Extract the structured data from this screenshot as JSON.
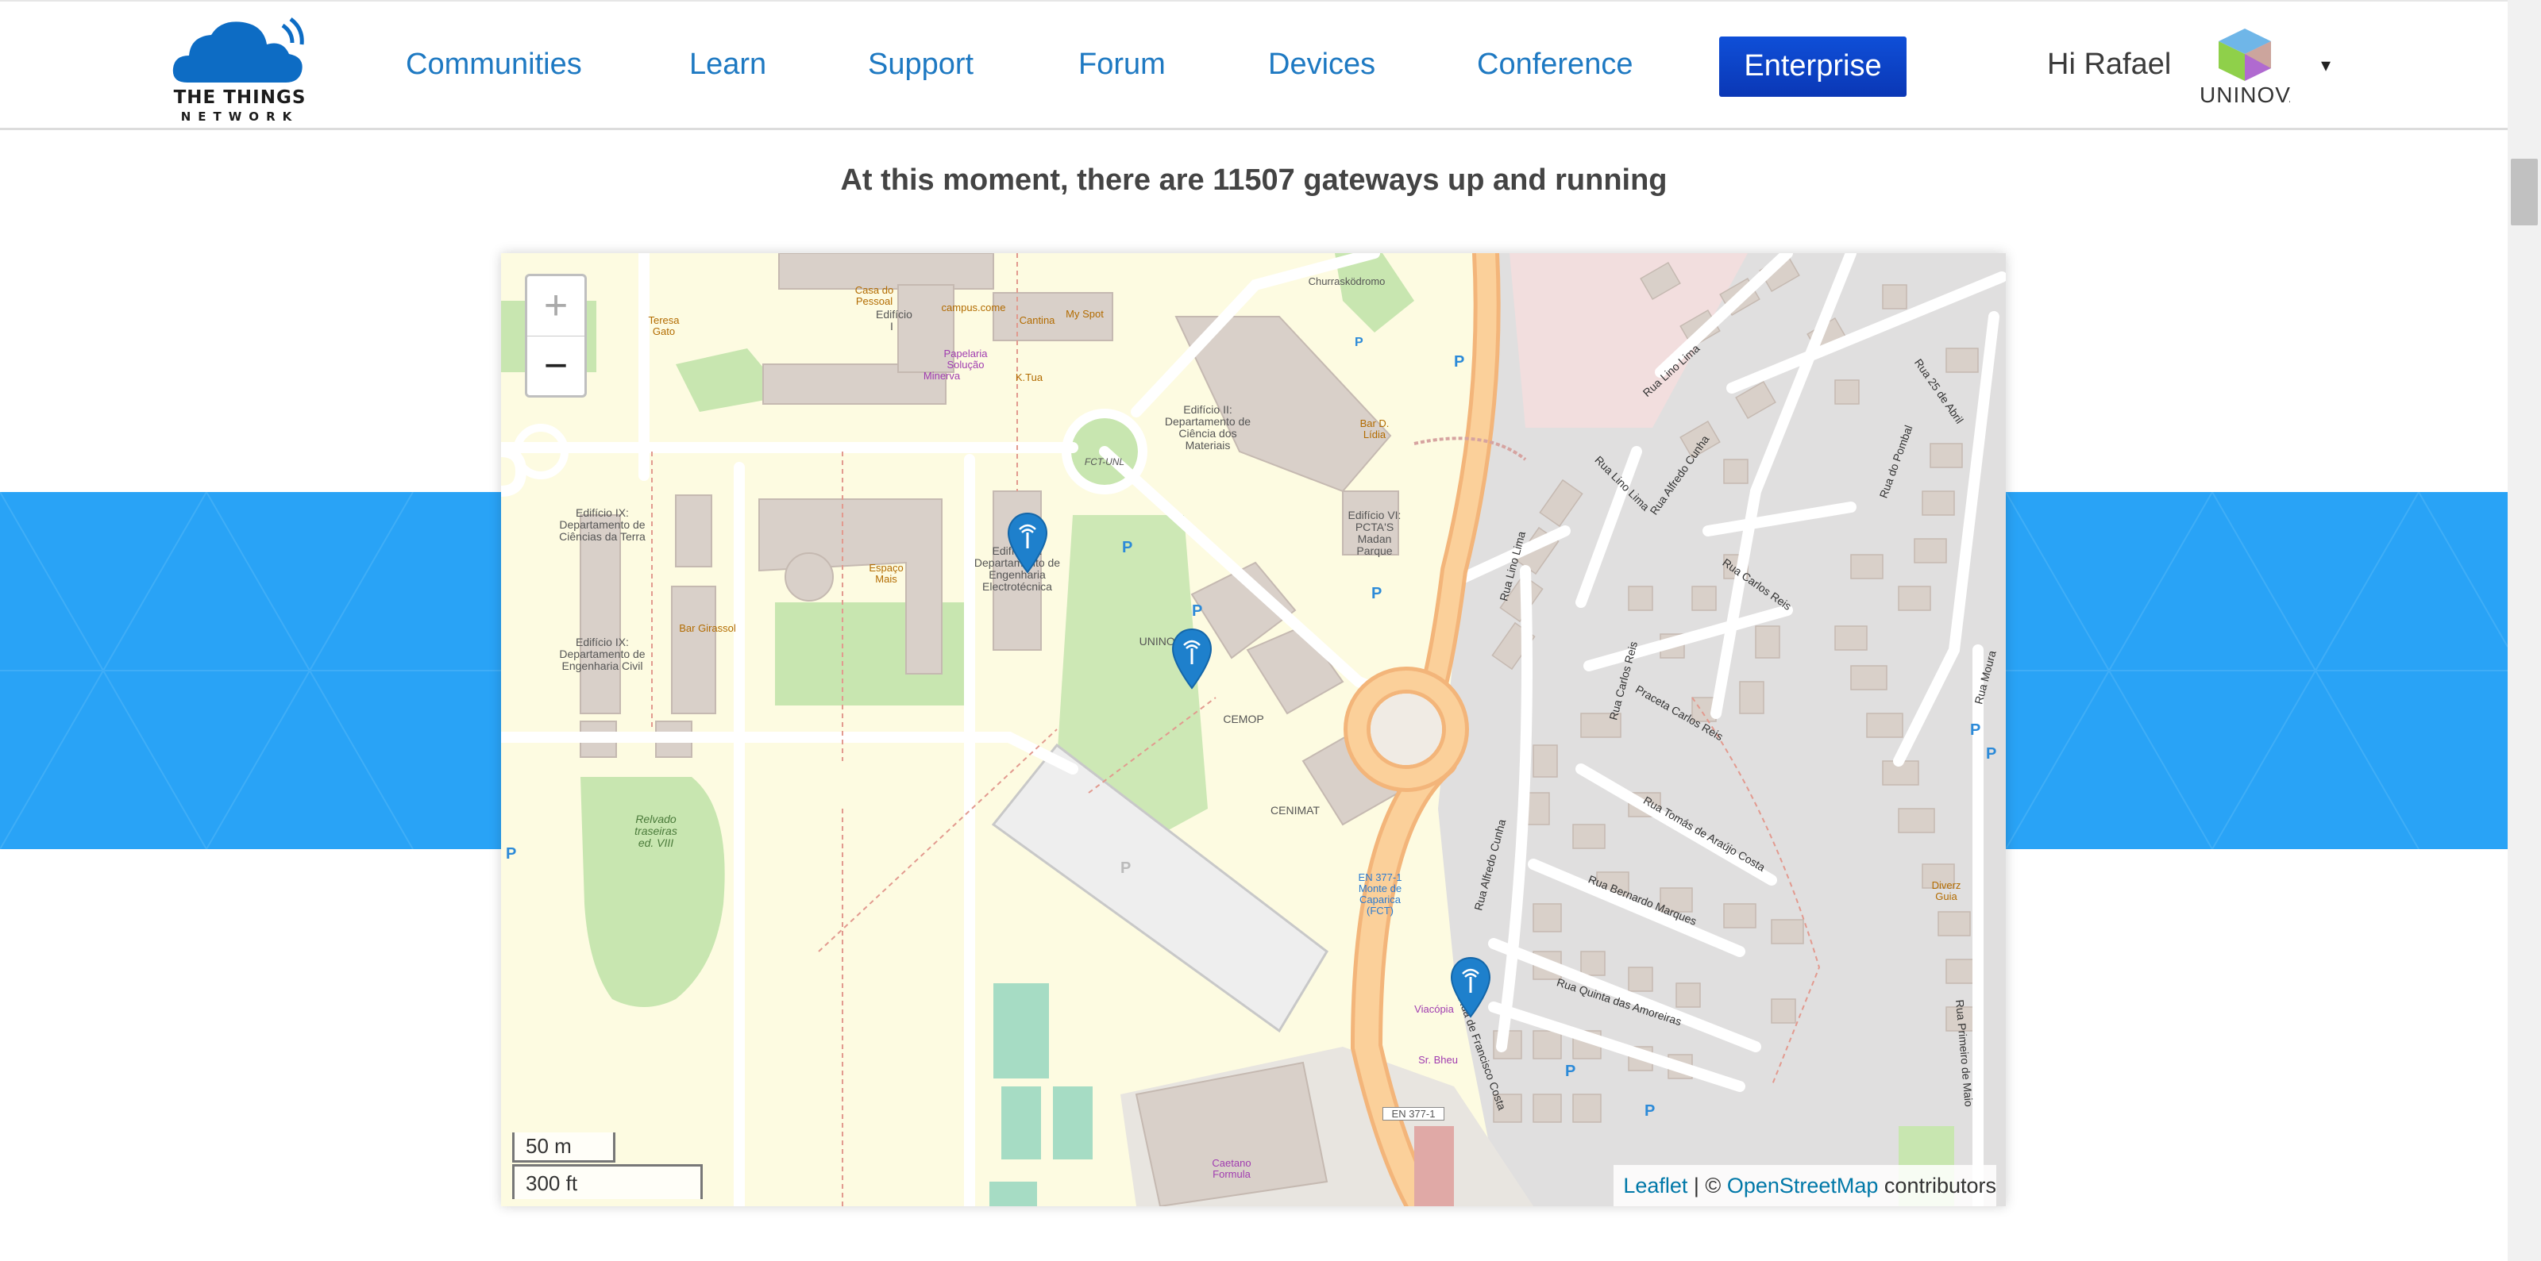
{
  "header": {
    "logo_line1": "THE THINGS",
    "logo_line2": "NETWORK",
    "nav": [
      {
        "label": "Communities"
      },
      {
        "label": "Learn"
      },
      {
        "label": "Support"
      },
      {
        "label": "Forum"
      },
      {
        "label": "Devices"
      },
      {
        "label": "Conference"
      }
    ],
    "enterprise_label": "Enterprise",
    "greeting": "Hi Rafael",
    "avatar_text": "UNINOVA",
    "dropdown_icon": "▾"
  },
  "headline": "At this moment, there are 11507 gateways up and running",
  "map": {
    "zoom_in": "+",
    "zoom_out": "−",
    "scale_metric": "50 m",
    "scale_imperial": "300 ft",
    "attribution": {
      "leaflet": "Leaflet",
      "sep": " | © ",
      "osm": "OpenStreetMap",
      "suffix": " contributors"
    },
    "gateway_markers": 3,
    "labels": {
      "ed1": "Edifício I",
      "ed2": "Edifício II: Departamento de Ciência dos Materiais",
      "ed6": "Edifício VI: PCTA'S Madan Parque",
      "ed9a": "Edifício IX: Departamento de Ciências da Terra",
      "ed9b": "Edifício IX: Departamento de Engenharia Civil",
      "ed10": "Edifício X: Departamento de Engenharia Electrotécnica",
      "uninova": "UNINOVA",
      "cemop": "CEMOP",
      "cenimat": "CENIMAT",
      "relvado": "Relvado traseiras ed. VIII",
      "fct": "FCT-UNL",
      "churras": "Churrasködromo",
      "en3771": "EN 377-1",
      "bus": "EN 377-1 Monte de Caparica (FCT)",
      "caetano": "Caetano Formula",
      "viacopia": "Viacópia",
      "sr": "Sr. Bheu",
      "diverz": "Diverz Guia"
    },
    "amenities": {
      "casa": "Casa do Pessoal",
      "campus": "campus.come",
      "cantina": "Cantina",
      "myspot": "My Spot",
      "papelaria": "Papelaria Solução",
      "minerva": "Minerva",
      "teresa": "Teresa Gato",
      "ktua": "K.Tua",
      "bard": "Bar D. Lídia",
      "bargirassol": "Bar Girassol",
      "espaco": "Espaço Mais"
    },
    "streets": {
      "s1": "Rua Lino Lima",
      "s2": "Rua Lino Lima",
      "s3": "Rua Alfredo Cunha",
      "s4": "Rua Carlos Reis",
      "s5": "Praceta Carlos Reis",
      "s6": "Rua Tomás de Araújo Costa",
      "s7": "Rua Bernardo Marques",
      "s8": "Rua Quinta das Amoreiras",
      "s9": "Rua Alfredo Cunha",
      "s10": "Rua de Francisco Costa",
      "s11": "Rua do Pombal",
      "s12": "Rua Primeiro de Maio",
      "s13": "Rua Lino Lima",
      "s14": "Rua Carlos Reis",
      "s15": "Rua 25 de Abril",
      "s16": "Rua Moura"
    }
  }
}
